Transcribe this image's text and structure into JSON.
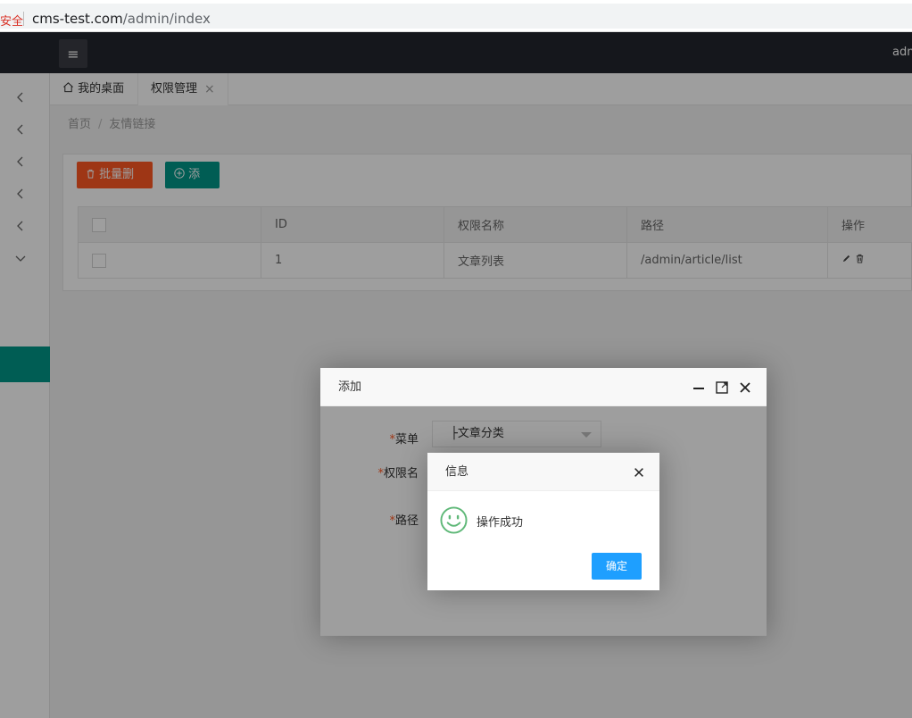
{
  "browser": {
    "insecure_label": "安全",
    "url_host": "cms-test.com",
    "url_path": "/admin/index"
  },
  "header": {
    "menu_icon": "≡",
    "user_label": "admin"
  },
  "tabs": [
    {
      "label": "我的桌面",
      "icon": "home-icon"
    },
    {
      "label": "权限管理",
      "close": "×"
    }
  ],
  "breadcrumb": {
    "items": [
      "首页",
      "友情链接"
    ],
    "separator": "/"
  },
  "toolbar": {
    "batch_delete_label": "批量删除",
    "add_label": "添加"
  },
  "table": {
    "headers": [
      "",
      "ID",
      "权限名称",
      "路径",
      "操作"
    ],
    "rows": [
      {
        "id": "1",
        "name": "文章列表",
        "path": "/admin/article/list"
      }
    ]
  },
  "add_dialog": {
    "title": "添加",
    "fields": [
      {
        "label": "菜单",
        "value": "├文章分类"
      },
      {
        "label": "权限名"
      },
      {
        "label": "路径"
      }
    ],
    "required_mark": "*"
  },
  "info_dialog": {
    "title": "信息",
    "message": "操作成功",
    "confirm_label": "确定"
  },
  "colors": {
    "header_bg": "#23262e",
    "accent": "#009688",
    "danger": "#ff5722",
    "confirm": "#1e9fff",
    "success_icon": "#5fb878"
  }
}
